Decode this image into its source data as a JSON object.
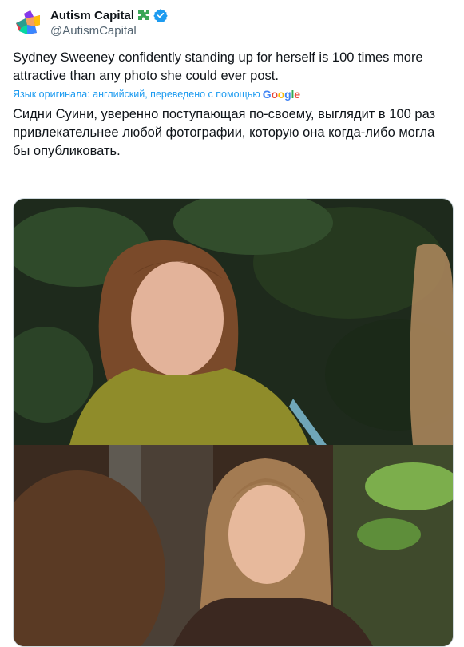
{
  "author": {
    "display_name": "Autism Capital",
    "handle": "@AutismCapital",
    "name_icon": "puzzle-piece-icon",
    "verified_icon": "verified-badge-icon"
  },
  "tweet": {
    "text": "Sydney Sweeney confidently standing up for herself is 100 times more attractive than any photo she could ever post.",
    "translation_label": "Язык оригинала: английский, переведено с помощью",
    "translation_provider": "Google",
    "translated_text": "Сидни Суини, уверенно поступающая по-своему, выглядит в 100 раз привлекательнее любой фотографии, которую она когда-либо могла бы опубликовать."
  },
  "colors": {
    "link": "#1d9bf0",
    "text": "#0f1419",
    "secondary": "#536471",
    "verified": "#1d9bf0"
  }
}
